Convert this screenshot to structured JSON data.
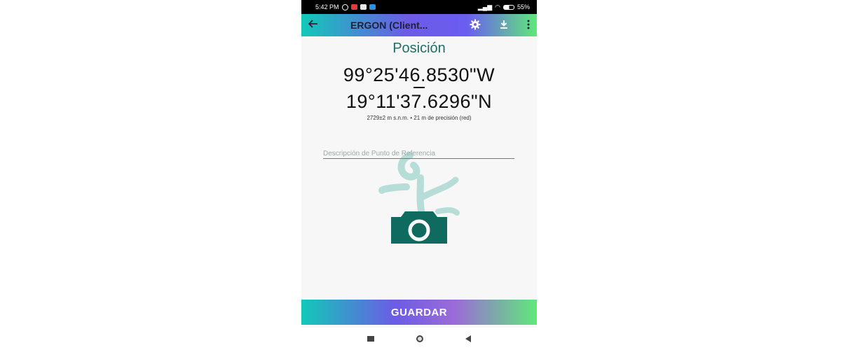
{
  "status_bar": {
    "time": "5:42 PM",
    "battery": "55%"
  },
  "app_bar": {
    "back_icon": "arrow-left-icon",
    "title": "ERGON (Client...",
    "actions": [
      "gear-icon",
      "download-icon",
      "more-vert-icon"
    ]
  },
  "main": {
    "heading": "Posición",
    "longitude": "99°25'46.8530\"W",
    "latitude": "19°11'37.6296\"N",
    "meta": "2729±2 m s.n.m. • 21 m de precisión (red)",
    "description_placeholder": "Descripción de Punto de Referencia",
    "description_value": "",
    "camera_icon": "camera-icon"
  },
  "save_button": {
    "label": "GUARDAR"
  },
  "colors": {
    "accent_teal": "#1f6f66",
    "camera_green": "#0f6b5f",
    "watermark": "#b7ddd8",
    "gradient_start": "#10c9b8",
    "gradient_mid": "#6d5be6",
    "gradient_end": "#5fe87a"
  }
}
